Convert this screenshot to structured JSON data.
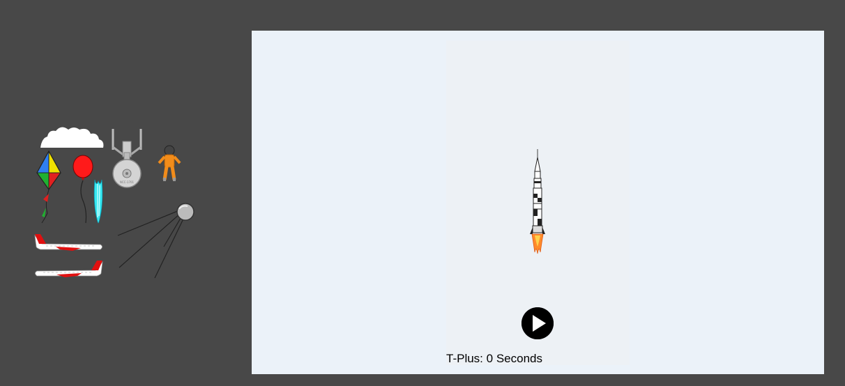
{
  "timer": {
    "prefix": "T-Plus:",
    "value": "0",
    "unit": "Seconds"
  },
  "play_button": {
    "icon": "play-icon",
    "color": "#000000"
  },
  "palette": {
    "background": "#484848",
    "game_panel": "#ebf2f9",
    "game_canvas": "#edf1f5"
  },
  "sprites": [
    "cloud-icon",
    "starship-icon",
    "astronaut-icon",
    "kite-icon",
    "balloon-icon",
    "jellyfish-icon",
    "satellite-icon",
    "airplane-icon",
    "airplane-icon",
    "rocket-icon"
  ]
}
